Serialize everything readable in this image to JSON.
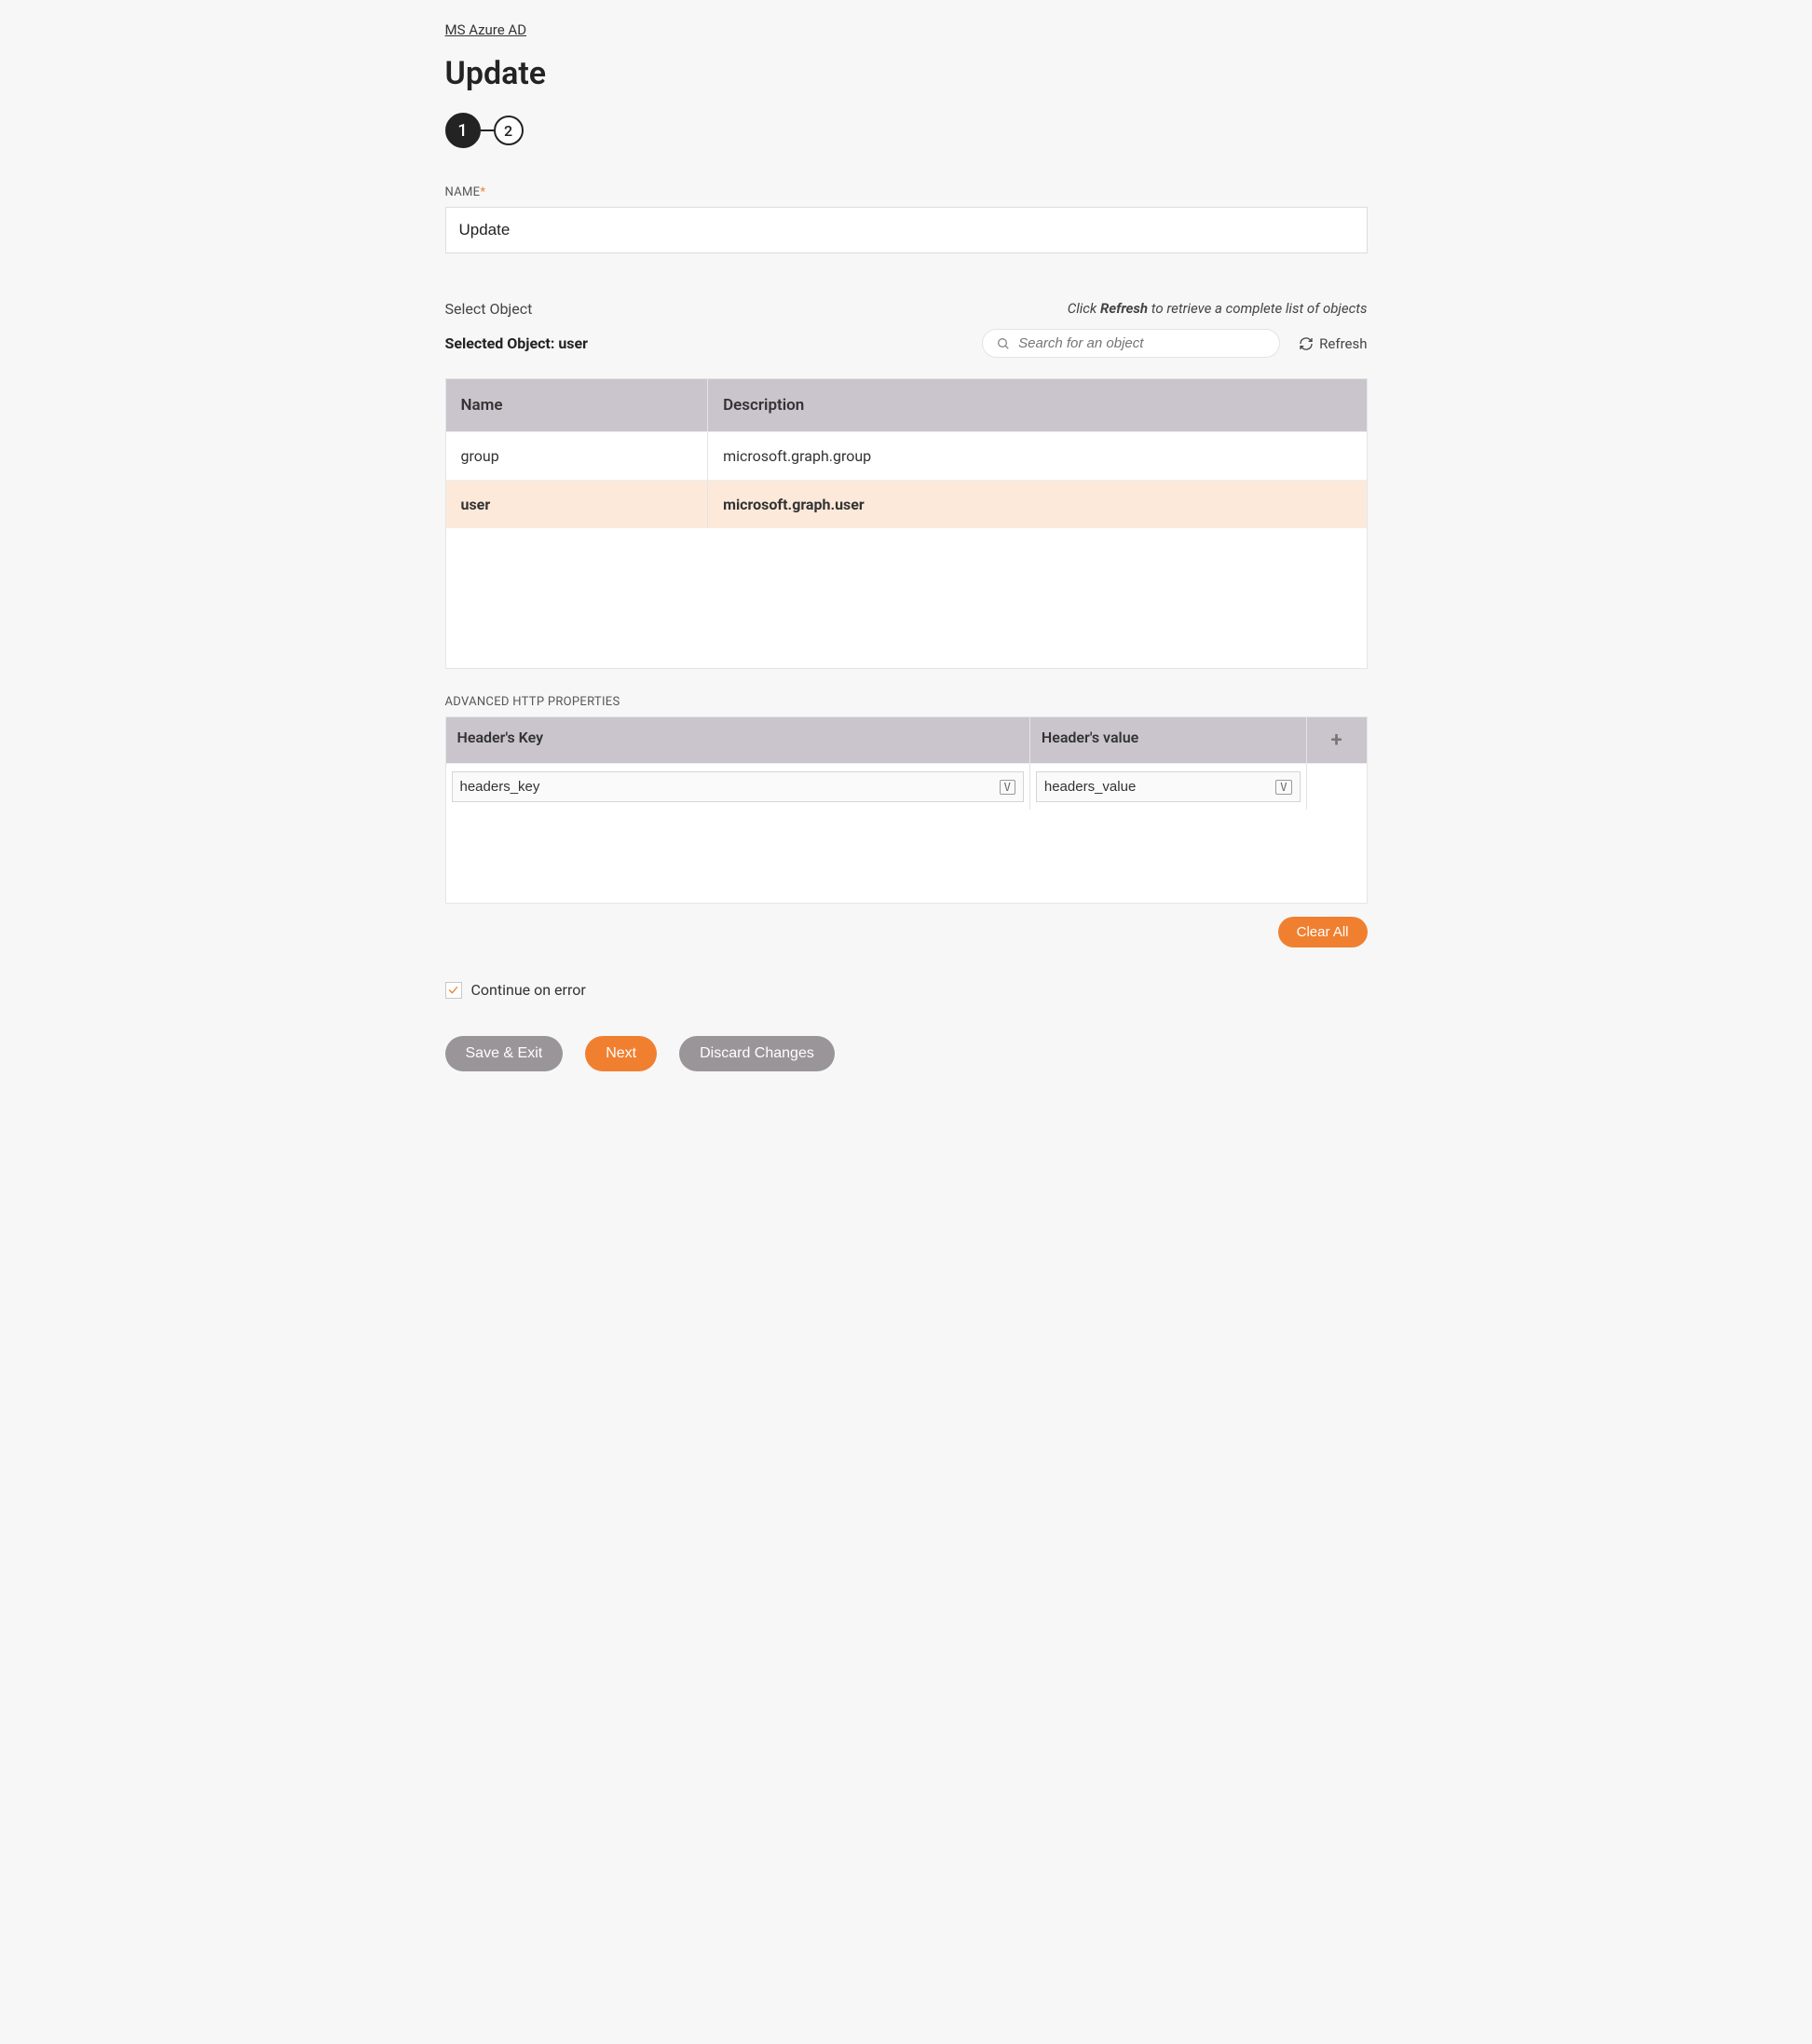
{
  "breadcrumb": "MS Azure AD",
  "page_title": "Update",
  "stepper": {
    "step1": "1",
    "step2": "2"
  },
  "name_field": {
    "label": "NAME",
    "value": "Update"
  },
  "select_object": {
    "label": "Select Object",
    "hint_prefix": "Click ",
    "hint_bold": "Refresh",
    "hint_suffix": " to retrieve a complete list of objects",
    "selected_prefix": "Selected Object: ",
    "selected_value": "user",
    "search_placeholder": "Search for an object",
    "refresh_label": "Refresh"
  },
  "object_table": {
    "columns": {
      "name": "Name",
      "description": "Description"
    },
    "rows": [
      {
        "name": "group",
        "description": "microsoft.graph.group",
        "selected": false
      },
      {
        "name": "user",
        "description": "microsoft.graph.user",
        "selected": true
      }
    ]
  },
  "http_section": {
    "label": "ADVANCED HTTP PROPERTIES",
    "columns": {
      "key": "Header's Key",
      "value": "Header's value"
    },
    "rows": [
      {
        "key": "headers_key",
        "value": "headers_value"
      }
    ],
    "clear_all": "Clear All"
  },
  "continue_on_error": {
    "label": "Continue on error",
    "checked": true
  },
  "footer": {
    "save_exit": "Save & Exit",
    "next": "Next",
    "discard": "Discard Changes"
  }
}
